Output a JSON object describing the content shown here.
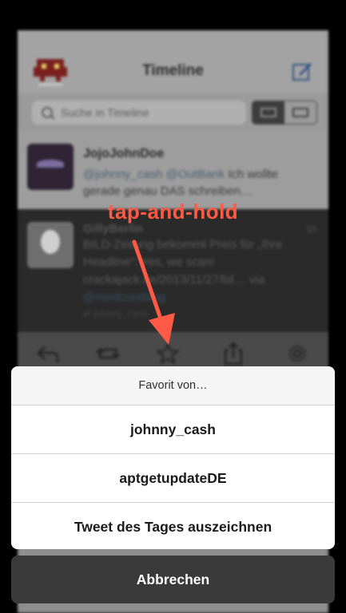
{
  "app": {
    "title": "Timeline",
    "search_placeholder": "Suche in Timeline"
  },
  "tweets": [
    {
      "author": "JojoJohnDoe",
      "text_mentions": "@johnny_cash @OutBank",
      "text_rest": " Ich wollte gerade genau DAS schreiben…"
    },
    {
      "author": "GillyBerlin",
      "time": "1h",
      "text_main": "BILD-Zeitung bekommt Preis für „Ihre Headline\": Yes, we scan! crackajack.de/2013/11/27/bil… via",
      "text_mention": "@nerdcoreblog",
      "retweet": "johnny_cash"
    }
  ],
  "annotation": {
    "label": "tap-and-hold",
    "color": "#ff5a45"
  },
  "action_sheet": {
    "header": "Favorit von…",
    "options": [
      "johnny_cash",
      "aptgetupdateDE",
      "Tweet des Tages auszeichnen"
    ],
    "cancel": "Abbrechen"
  },
  "icons": {
    "app_logo": "space-invader-icon",
    "compose": "compose-icon",
    "search": "search-icon",
    "layout_toggle": "layout-toggle-icon",
    "reply": "reply-icon",
    "retweet": "retweet-icon",
    "favorite": "star-icon",
    "share": "share-icon",
    "settings": "gear-icon"
  }
}
